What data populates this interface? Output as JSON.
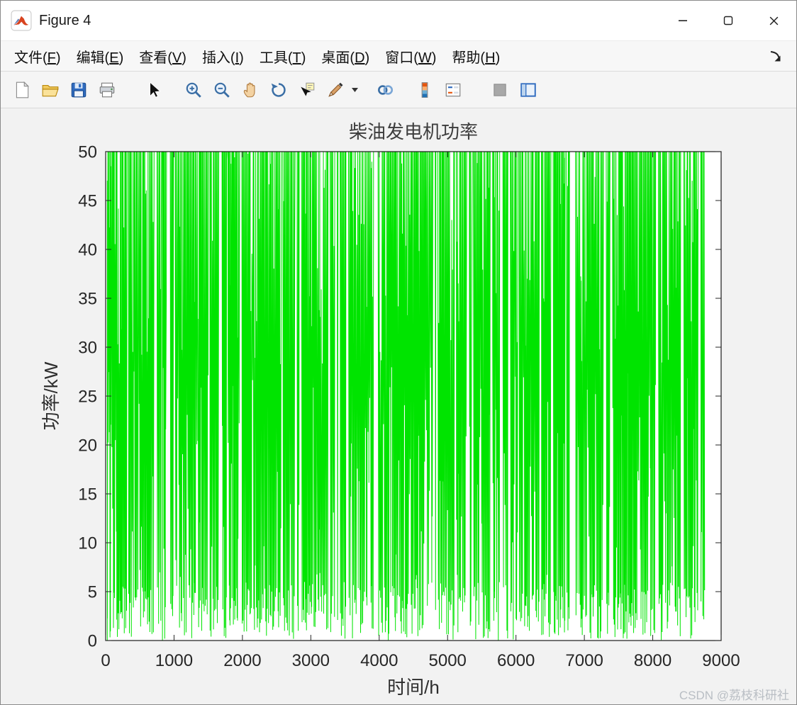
{
  "window": {
    "title": "Figure 4",
    "controls": {
      "minimize": "minimize-button",
      "maximize": "maximize-button",
      "close": "close-button"
    }
  },
  "menu": {
    "items": [
      {
        "label": "文件(F)"
      },
      {
        "label": "编辑(E)"
      },
      {
        "label": "查看(V)"
      },
      {
        "label": "插入(I)"
      },
      {
        "label": "工具(T)"
      },
      {
        "label": "桌面(D)"
      },
      {
        "label": "窗口(W)"
      },
      {
        "label": "帮助(H)"
      }
    ]
  },
  "toolbar": {
    "icons": [
      "new-figure-icon",
      "open-file-icon",
      "save-figure-icon",
      "print-figure-icon",
      "edit-pointer-icon",
      "zoom-in-icon",
      "zoom-out-icon",
      "pan-icon",
      "rotate-3d-icon",
      "data-cursor-icon",
      "brush-data-icon",
      "brush-dropdown-icon",
      "link-plots-icon",
      "insert-colorbar-icon",
      "insert-legend-icon",
      "hide-plot-tools-icon",
      "show-plot-tools-dock-icon"
    ]
  },
  "chart_data": {
    "type": "line",
    "title": "柴油发电机功率",
    "xlabel": "时间/h",
    "ylabel": "功率/kW",
    "xlim": [
      0,
      9000
    ],
    "ylim": [
      0,
      50
    ],
    "xticks": [
      0,
      1000,
      2000,
      3000,
      4000,
      5000,
      6000,
      7000,
      8000,
      9000
    ],
    "yticks": [
      0,
      5,
      10,
      15,
      20,
      25,
      30,
      35,
      40,
      45,
      50
    ],
    "grid": false,
    "box": true,
    "legend": null,
    "series": [
      {
        "name": "柴油发电机功率",
        "color": "#00e400",
        "line_width": 1,
        "x_start": 24,
        "x_end": 8760,
        "description": "高频开关式波动信号：在 0 与 50 kW 之间密集振荡，大量峰值削顶于 50 kW，覆盖约 0–8760 h，其间有少量窄白色间隙"
      }
    ]
  },
  "watermark": {
    "text": "CSDN @荔枝科研社"
  }
}
